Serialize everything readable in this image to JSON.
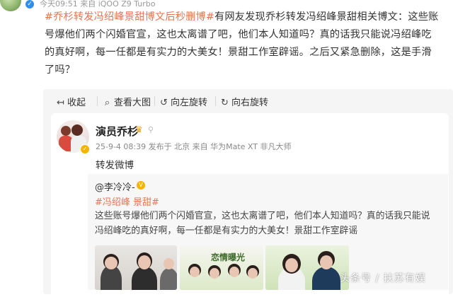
{
  "header": {
    "meta": "今天09:51 来自 iQOO Z9 Turbo"
  },
  "post": {
    "tag_prefix": "#乔杉转发冯绍峰景甜博文后秒删博#",
    "line1_rest": "有网友发现乔杉转发冯绍峰景甜相关博文：这些账",
    "line2": "号爆他们两个闪婚官宣，这也太离谱了吧，他们本人知道吗？真的话我只能说冯绍峰吃",
    "line3": "的真好啊，每一任都是有实力的大美女！景甜工作室辟谣。之后又紧急删除，这是手滑",
    "line4": "了吗？"
  },
  "toolbar": {
    "collapse": "收起",
    "view_large": "查看大图",
    "rotate_left": "向左旋转",
    "rotate_right": "向右旋转"
  },
  "card": {
    "author": "演员乔杉",
    "meta": "25-9-4 08:39 发布于 北京 来自 华为Mate XT 非凡大师",
    "forward_text": "转发微博",
    "quote": {
      "user": "@李冷冷-",
      "tags": "#冯绍峰 景甜#",
      "text": "这些账号爆他们两个闪婚官宣，这也太离谱了吧，他们本人知道吗？真的话我只能说冯绍峰吃的真好啊，每一任都是有实力的大美女！景甜工作室辟谣"
    },
    "poster_title": "恋情曝光"
  },
  "watermark": "头条号 / 扶苏有娱",
  "colors": {
    "tag": "#eb7350",
    "panel": "#f5f5f5",
    "verify": "#2f8ef0",
    "gold_badge": "#f5b400"
  },
  "icons": [
    "arrow-left-icon",
    "magnify-icon",
    "rotate-left-icon",
    "rotate-right-icon",
    "crown-icon",
    "vip-icon",
    "verified-icon"
  ]
}
